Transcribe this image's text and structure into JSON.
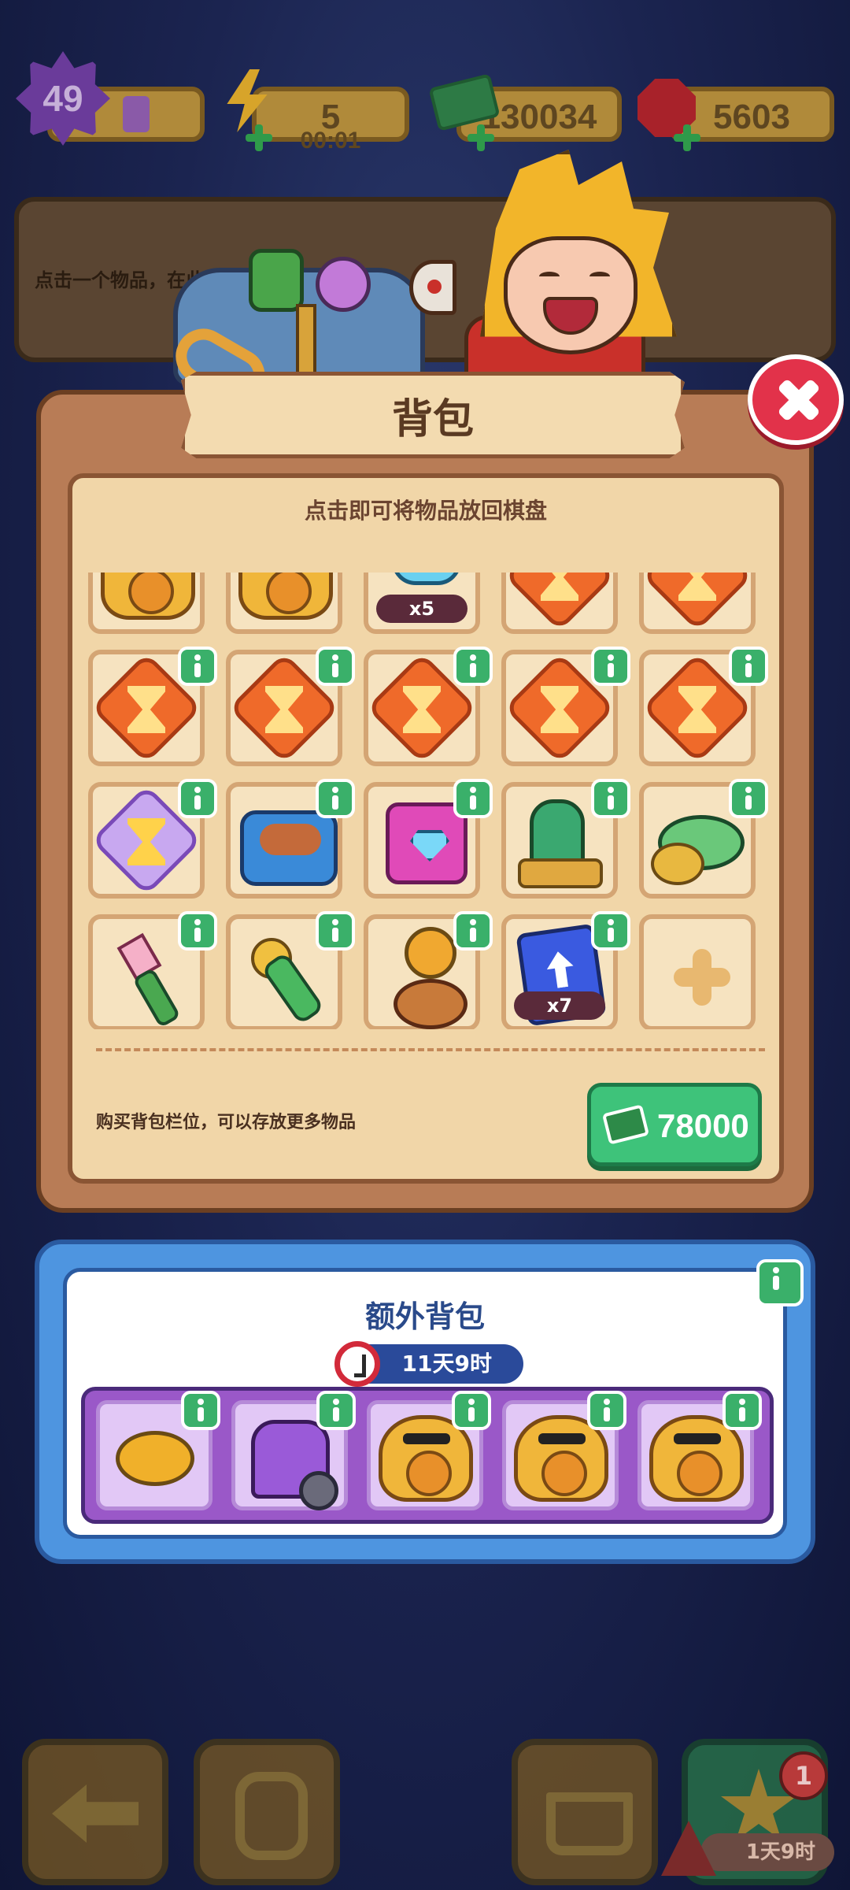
{
  "top_bar": {
    "level": "49",
    "energy": "5",
    "energy_timer": "00:01",
    "cash": "130034",
    "gems": "5603"
  },
  "info_banner": {
    "text": "点击一个物品，在此处..."
  },
  "backpack": {
    "title": "背包",
    "subtitle": "点击即可将物品放回棋盘",
    "rows": [
      [
        {
          "item": "lucky-cat",
          "count": ""
        },
        {
          "item": "lucky-cat",
          "count": ""
        },
        {
          "item": "blue-gears",
          "count": "x5"
        },
        {
          "item": "hourglass-orange",
          "count": ""
        },
        {
          "item": "hourglass-orange",
          "count": ""
        }
      ],
      [
        {
          "item": "hourglass-orange",
          "count": ""
        },
        {
          "item": "hourglass-orange",
          "count": ""
        },
        {
          "item": "hourglass-orange",
          "count": ""
        },
        {
          "item": "hourglass-orange",
          "count": ""
        },
        {
          "item": "hourglass-orange",
          "count": ""
        }
      ],
      [
        {
          "item": "hourglass-purple",
          "count": ""
        },
        {
          "item": "lunchbox",
          "count": ""
        },
        {
          "item": "ring-box",
          "count": ""
        },
        {
          "item": "gingerbread",
          "count": ""
        },
        {
          "item": "bowl",
          "count": ""
        }
      ],
      [
        {
          "item": "brush",
          "count": ""
        },
        {
          "item": "shaker",
          "count": ""
        },
        {
          "item": "tower",
          "count": ""
        },
        {
          "item": "upgrade-card",
          "count": "x7"
        },
        {
          "item": "add-slot",
          "count": ""
        }
      ]
    ],
    "buy_text": "购买背包栏位，可以存放更多物品",
    "buy_price": "78000"
  },
  "extra_bag": {
    "title": "额外背包",
    "timer": "11天9时",
    "items": [
      "cheese",
      "scooter",
      "lucky-cat",
      "lucky-cat",
      "lucky-cat"
    ]
  },
  "bottom_nav": {
    "notification_count": "1",
    "event_timer": "1天9时"
  },
  "colors": {
    "panel_brown": "#b87c56",
    "panel_cream": "#f1d6a8",
    "green_button": "#3ec37a",
    "close_red": "#e2324a",
    "extra_blue": "#4e95e0",
    "extra_purple": "#9a58c8"
  }
}
